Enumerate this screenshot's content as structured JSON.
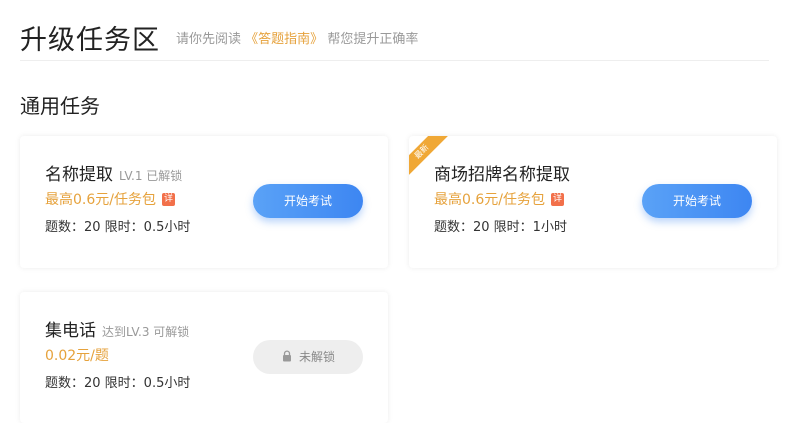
{
  "header": {
    "title": "升级任务区",
    "hint_prefix": "请你先阅读",
    "hint_link": "《答题指南》",
    "hint_suffix": "帮您提升正确率"
  },
  "section": {
    "title": "通用任务"
  },
  "tasks": [
    {
      "name": "名称提取",
      "level": "LV.1 已解锁",
      "reward": "最高0.6元/任务包",
      "detail_icon": "详",
      "stats": "题数：20  限时：0.5小时",
      "button_label": "开始考试",
      "locked": false,
      "new_badge": ""
    },
    {
      "name": "商场招牌名称提取",
      "level": "",
      "reward": "最高0.6元/任务包",
      "detail_icon": "详",
      "stats": "题数：20  限时：1小时",
      "button_label": "开始考试",
      "locked": false,
      "new_badge": "最新"
    },
    {
      "name": "集电话",
      "level": "达到LV.3 可解锁",
      "reward": "0.02元/题",
      "detail_icon": "",
      "stats": "题数：20  限时：0.5小时",
      "button_label": "未解锁",
      "locked": true,
      "new_badge": ""
    }
  ],
  "colors": {
    "accent_orange": "#e6a23c",
    "button_blue": "#3d86f2",
    "locked_gray": "#eeeeee",
    "badge_orange": "#f0a836"
  },
  "icons": {
    "lock": "lock-icon",
    "detail": "detail-icon"
  }
}
